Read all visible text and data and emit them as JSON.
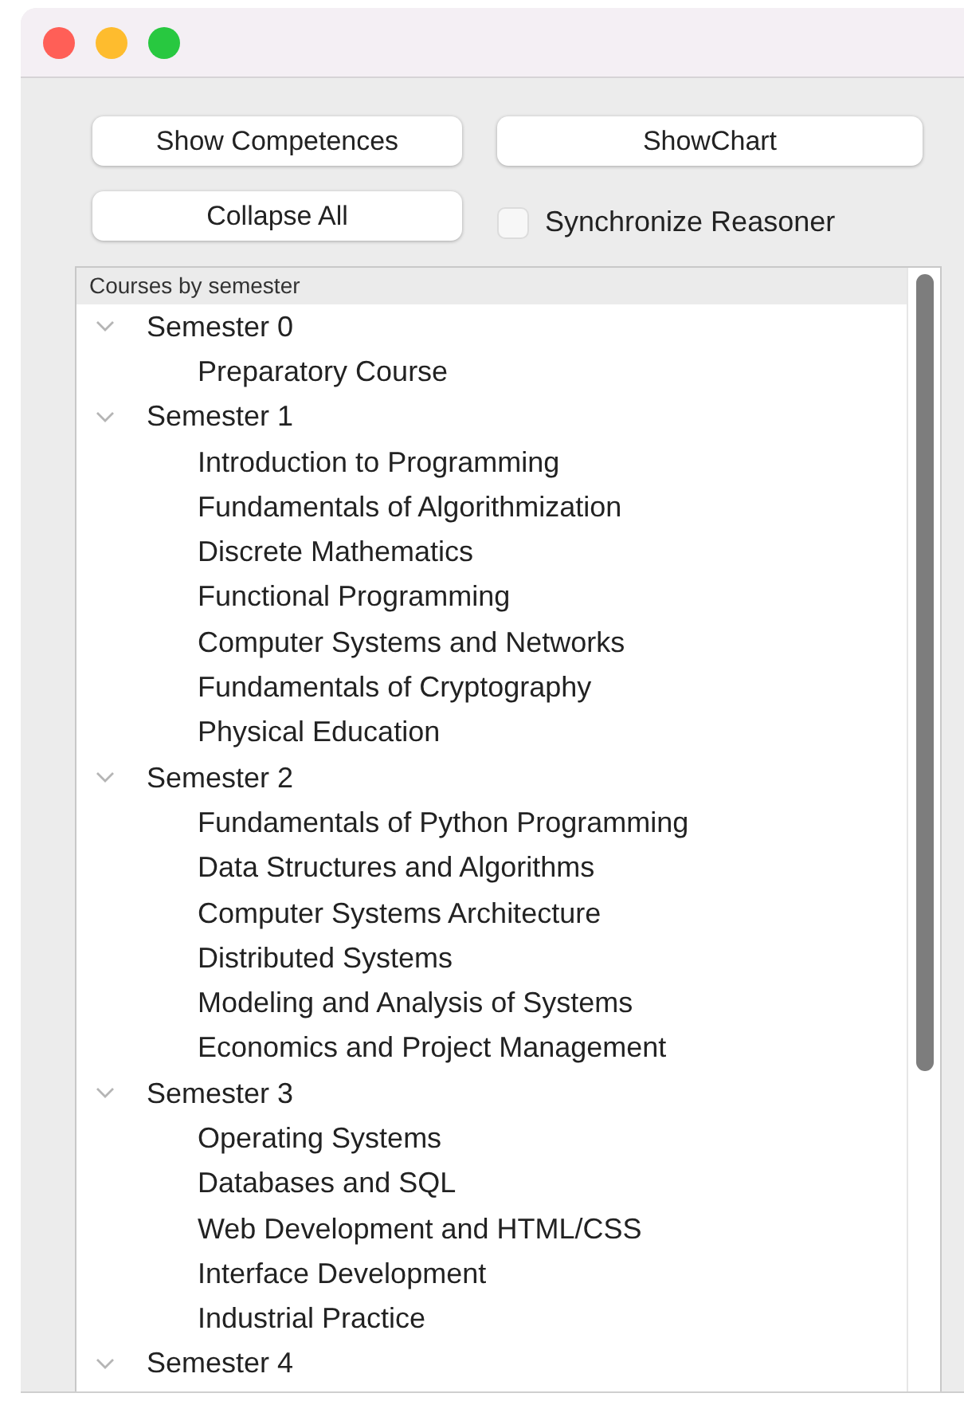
{
  "buttons": [
    {
      "label": "Show Competences"
    },
    {
      "label": "ShowChart"
    },
    {
      "label": "Collapse All"
    }
  ],
  "sync_checkbox": {
    "label": "Synchronize Reasoner",
    "checked": false
  },
  "tree": {
    "header": "Courses by semester",
    "items": [
      {
        "label": "Semester 0",
        "expanded": true,
        "children": [
          {
            "label": "Preparatory Course"
          }
        ]
      },
      {
        "label": "Semester 1",
        "expanded": true,
        "children": [
          {
            "label": "Introduction to Programming"
          },
          {
            "label": "Fundamentals of Algorithmization"
          },
          {
            "label": "Discrete Mathematics"
          },
          {
            "label": "Functional Programming"
          },
          {
            "label": "Computer Systems and Networks"
          },
          {
            "label": "Fundamentals of Cryptography"
          },
          {
            "label": "Physical Education"
          }
        ]
      },
      {
        "label": "Semester 2",
        "expanded": true,
        "children": [
          {
            "label": "Fundamentals of Python Programming"
          },
          {
            "label": "Data Structures and Algorithms"
          },
          {
            "label": "Computer Systems Architecture"
          },
          {
            "label": "Distributed Systems"
          },
          {
            "label": "Modeling and Analysis of Systems"
          },
          {
            "label": "Economics and Project Management"
          }
        ]
      },
      {
        "label": "Semester 3",
        "expanded": true,
        "children": [
          {
            "label": "Operating Systems"
          },
          {
            "label": "Databases and SQL"
          },
          {
            "label": "Web Development and HTML/CSS"
          },
          {
            "label": "Interface Development"
          },
          {
            "label": "Industrial Practice"
          }
        ]
      },
      {
        "label": "Semester 4",
        "expanded": true
      }
    ]
  }
}
